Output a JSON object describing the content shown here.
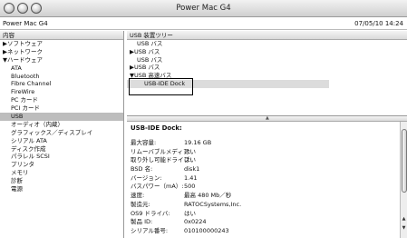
{
  "window": {
    "title": "Power Mac G4"
  },
  "infobar": {
    "machine": "Power Mac G4",
    "datetime": "07/05/10 14:24"
  },
  "left_pane": {
    "header": "内容",
    "items": [
      {
        "label": "▶ソフトウェア",
        "indent": 0
      },
      {
        "label": "▶ネットワーク",
        "indent": 0
      },
      {
        "label": "▼ハードウェア",
        "indent": 0
      },
      {
        "label": "ATA",
        "indent": 1
      },
      {
        "label": "Bluetooth",
        "indent": 1
      },
      {
        "label": "Fibre Channel",
        "indent": 1
      },
      {
        "label": "FireWire",
        "indent": 1
      },
      {
        "label": "PC カード",
        "indent": 1
      },
      {
        "label": "PCI カード",
        "indent": 1
      },
      {
        "label": "USB",
        "indent": 1,
        "selected": true
      },
      {
        "label": "オーディオ（内蔵）",
        "indent": 1
      },
      {
        "label": "グラフィックス／ディスプレイ",
        "indent": 1
      },
      {
        "label": "シリアル ATA",
        "indent": 1
      },
      {
        "label": "ディスク作成",
        "indent": 1
      },
      {
        "label": "パラレル SCSI",
        "indent": 1
      },
      {
        "label": "プリンタ",
        "indent": 1
      },
      {
        "label": "メモリ",
        "indent": 1
      },
      {
        "label": "診断",
        "indent": 1
      },
      {
        "label": "電源",
        "indent": 1
      }
    ]
  },
  "usb_tree": {
    "header": "USB 装置ツリー",
    "items": [
      {
        "label": "USB バス",
        "indent": 1
      },
      {
        "label": "▶USB バス",
        "indent": 0
      },
      {
        "label": "USB バス",
        "indent": 1
      },
      {
        "label": "▶USB バス",
        "indent": 0
      },
      {
        "label": "▼USB 高速バス",
        "indent": 0
      },
      {
        "label": "USB-IDE Dock",
        "indent": 2,
        "selected": true
      }
    ]
  },
  "detail": {
    "title": "USB-IDE Dock:",
    "rows": [
      {
        "label": "最大容量:",
        "value": "19.16 GB"
      },
      {
        "label": "リムーバブルメディア:",
        "value": "はい"
      },
      {
        "label": "取り外し可能ドライブ:",
        "value": "はい"
      },
      {
        "label": "BSD 名:",
        "value": "disk1"
      },
      {
        "label": "バージョン:",
        "value": "1.41"
      },
      {
        "label": "バスパワー（mA）:",
        "value": "500"
      },
      {
        "label": "速度:",
        "value": "最高 480 Mb／秒"
      },
      {
        "label": "製造元:",
        "value": "RATOCSystems,Inc."
      },
      {
        "label": "OS9 ドライバ:",
        "value": "はい"
      },
      {
        "label": "製品 ID:",
        "value": "0x0224"
      },
      {
        "label": "シリアル番号:",
        "value": "010100000243"
      }
    ]
  }
}
